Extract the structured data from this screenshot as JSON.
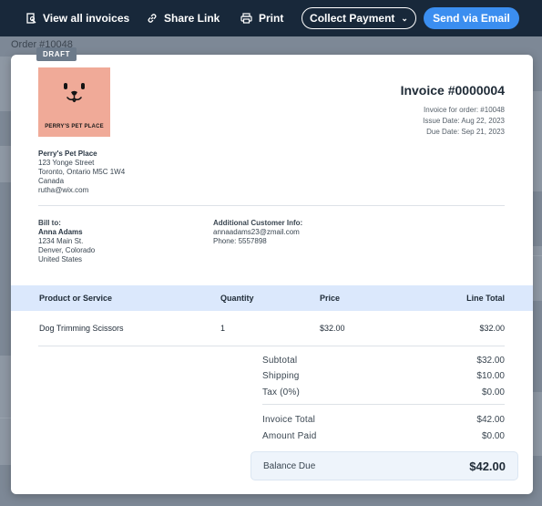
{
  "toolbar": {
    "view_all": "View all invoices",
    "share_link": "Share Link",
    "print": "Print",
    "collect_payment": "Collect Payment",
    "send_email": "Send via Email"
  },
  "background": {
    "order_label": "Order #10048"
  },
  "invoice": {
    "status_badge": "DRAFT",
    "logo_text": "PERRY'S PET PLACE",
    "title": "Invoice #0000004",
    "meta": {
      "order": "Invoice for order: #10048",
      "issue_date": "Issue Date: Aug 22, 2023",
      "due_date": "Due Date: Sep 21, 2023"
    },
    "seller": {
      "name": "Perry's Pet Place",
      "street": "123 Yonge Street",
      "city": "Toronto, Ontario M5C 1W4",
      "country": "Canada",
      "email": "rutha@wix.com"
    },
    "bill_to": {
      "header": "Bill to:",
      "name": "Anna Adams",
      "street": "1234 Main St.",
      "city": "Denver, Colorado",
      "country": "United States"
    },
    "additional_info": {
      "header": "Additional Customer Info:",
      "email": "annaadams23@zmail.com",
      "phone": "Phone: 5557898"
    },
    "table": {
      "headers": {
        "product": "Product or Service",
        "quantity": "Quantity",
        "price": "Price",
        "line_total": "Line Total"
      },
      "rows": [
        {
          "product": "Dog Trimming Scissors",
          "quantity": "1",
          "price": "$32.00",
          "line_total": "$32.00"
        }
      ]
    },
    "summary": {
      "subtotal_label": "Subtotal",
      "subtotal": "$32.00",
      "shipping_label": "Shipping",
      "shipping": "$10.00",
      "tax_label": "Tax (0%)",
      "tax": "$0.00",
      "invoice_total_label": "Invoice Total",
      "invoice_total": "$42.00",
      "amount_paid_label": "Amount Paid",
      "amount_paid": "$0.00",
      "balance_due_label": "Balance Due",
      "balance_due": "$42.00"
    }
  },
  "colors": {
    "toolbar_bg": "#18283a",
    "primary_button": "#3b8ef0",
    "logo_bg": "#f0aa98",
    "table_header_bg": "#dbe8fc",
    "draft_badge": "#6c7a8a"
  }
}
